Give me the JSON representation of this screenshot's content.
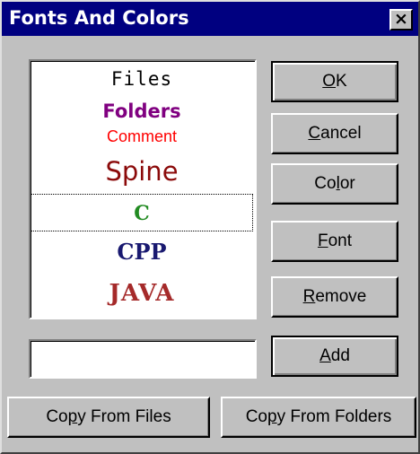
{
  "window": {
    "title": "Fonts And Colors",
    "close_glyph": "×"
  },
  "list": {
    "items": [
      {
        "label": "Files"
      },
      {
        "label": "Folders"
      },
      {
        "label": "Comment"
      },
      {
        "label": "Spine"
      },
      {
        "label": "C",
        "selected": true
      },
      {
        "label": "CPP"
      },
      {
        "label": "JAVA"
      }
    ]
  },
  "buttons": {
    "ok": {
      "pre": "",
      "accel": "O",
      "post": "K"
    },
    "cancel": {
      "pre": "",
      "accel": "C",
      "post": "ancel"
    },
    "color": {
      "pre": "Co",
      "accel": "l",
      "post": "or"
    },
    "font": {
      "pre": "",
      "accel": "F",
      "post": "ont"
    },
    "remove": {
      "pre": "",
      "accel": "R",
      "post": "emove"
    },
    "add": {
      "pre": "",
      "accel": "A",
      "post": "dd"
    },
    "copy_files": {
      "pre": "Co",
      "accel": "p",
      "post": "y From Files"
    },
    "copy_folders": {
      "pre": "Co",
      "accel": "p",
      "post": "y From Folders"
    }
  },
  "name_input": {
    "value": ""
  },
  "colors": {
    "title_bar": "#000080",
    "folders": "#800080",
    "comment": "#ff0000",
    "spine": "#8b0a0a",
    "c": "#228b22",
    "cpp": "#191970",
    "java": "#a52a2a"
  }
}
